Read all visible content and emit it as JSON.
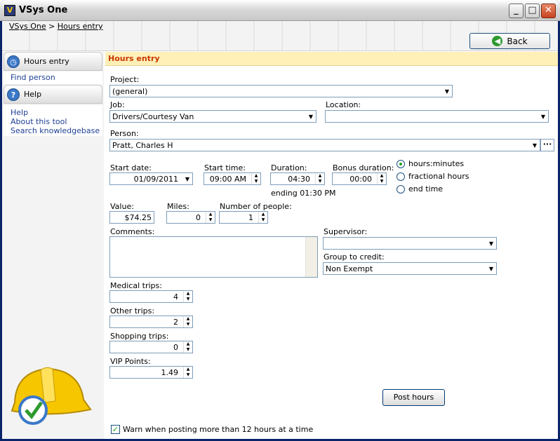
{
  "window": {
    "title": "VSys One"
  },
  "breadcrumb": {
    "root": "VSys One",
    "separator": ">",
    "current": "Hours entry"
  },
  "toolbar": {
    "back_label": "Back"
  },
  "sidebar": {
    "hours_entry": {
      "title": "Hours entry",
      "links": [
        "Find person"
      ]
    },
    "help": {
      "title": "Help",
      "links": [
        "Help",
        "About this tool",
        "Search knowledgebase"
      ]
    }
  },
  "form": {
    "header": "Hours entry",
    "project": {
      "label": "Project:",
      "value": "(general)"
    },
    "job": {
      "label": "Job:",
      "value": "Drivers/Courtesy Van"
    },
    "location": {
      "label": "Location:",
      "value": ""
    },
    "person": {
      "label": "Person:",
      "value": "Pratt, Charles H",
      "lookup": "···"
    },
    "start_date": {
      "label": "Start date:",
      "value": "01/09/2011"
    },
    "start_time": {
      "label": "Start time:",
      "value": "09:00 AM"
    },
    "duration": {
      "label": "Duration:",
      "value": "04:30",
      "ending": "ending 01:30 PM"
    },
    "bonus_duration": {
      "label": "Bonus duration:",
      "value": "00:00"
    },
    "duration_mode": {
      "options": [
        "hours:minutes",
        "fractional hours",
        "end time"
      ],
      "selected": "hours:minutes"
    },
    "value": {
      "label": "Value:",
      "value": "$74.25"
    },
    "miles": {
      "label": "Miles:",
      "value": "0"
    },
    "people": {
      "label": "Number of people:",
      "value": "1"
    },
    "comments": {
      "label": "Comments:",
      "value": ""
    },
    "supervisor": {
      "label": "Supervisor:",
      "value": ""
    },
    "group_to_credit": {
      "label": "Group to credit:",
      "value": "Non Exempt"
    },
    "medical_trips": {
      "label": "Medical trips:",
      "value": "4"
    },
    "other_trips": {
      "label": "Other trips:",
      "value": "2"
    },
    "shopping_trips": {
      "label": "Shopping trips:",
      "value": "0"
    },
    "vip_points": {
      "label": "VIP Points:",
      "value": "1.49"
    },
    "post_button": "Post hours",
    "warn": {
      "label": "Warn when posting more than 12 hours at a time",
      "checked": true
    }
  }
}
